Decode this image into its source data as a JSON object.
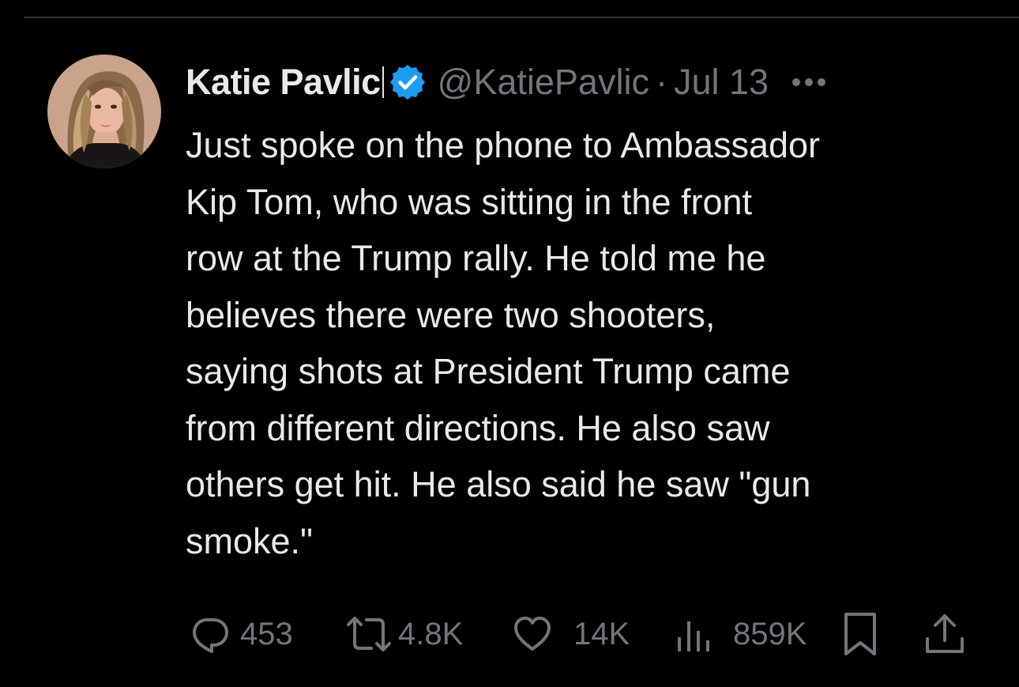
{
  "tweet": {
    "author": {
      "display_name": "Katie Pavlic",
      "handle": "@KatiePavlic",
      "verified": true,
      "avatar_icon": "profile-photo"
    },
    "separator": "·",
    "date": "Jul 13",
    "text_lines": [
      "Just spoke on the phone to Ambassador",
      "Kip Tom, who was sitting in the front",
      "row at the Trump rally. He told me he",
      "believes there were two shooters,",
      "saying shots at President Trump came",
      "from different directions. He also saw",
      "others get hit. He also said he saw \"gun",
      "smoke.\""
    ],
    "metrics": {
      "replies": "453",
      "reposts": "4.8K",
      "likes": "14K",
      "views": "859K"
    }
  },
  "colors": {
    "background": "#000000",
    "primary_text": "#e7e9ea",
    "secondary_text": "#71767b",
    "verified_badge": "#1d9bf0",
    "divider": "#2f3336"
  },
  "icons": {
    "verified": "verified-badge-icon",
    "more": "more-options-icon",
    "reply": "reply-bubble-icon",
    "repost": "repost-arrows-icon",
    "like": "heart-icon",
    "views": "views-bar-chart-icon",
    "bookmark": "bookmark-icon",
    "share": "share-upload-icon"
  }
}
